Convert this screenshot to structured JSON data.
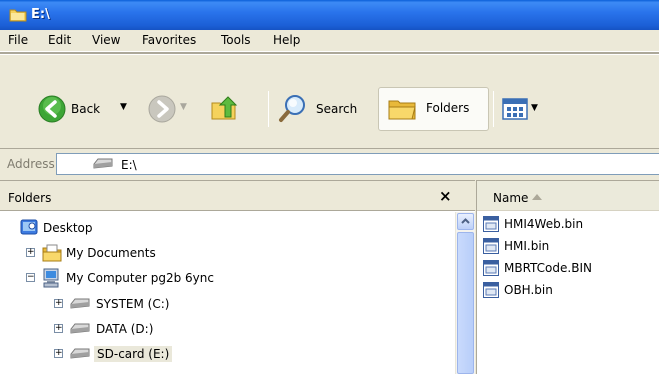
{
  "window": {
    "title": "E:\\"
  },
  "menu": [
    "File",
    "Edit",
    "View",
    "Favorites",
    "Tools",
    "Help"
  ],
  "toolbar": {
    "back_label": "Back",
    "search_label": "Search",
    "folders_label": "Folders"
  },
  "address": {
    "label": "Address",
    "value": "E:\\"
  },
  "folders_pane": {
    "title": "Folders",
    "close_glyph": "×",
    "tree": [
      {
        "label": "Desktop",
        "icon": "desktop-icon"
      },
      {
        "label": "My Documents",
        "icon": "my-documents-icon",
        "expander": "+"
      },
      {
        "label": "My Computer pg2b 6ync",
        "icon": "my-computer-icon",
        "expander": "−"
      },
      {
        "label": "SYSTEM (C:)",
        "icon": "drive-icon",
        "expander": "+"
      },
      {
        "label": "DATA (D:)",
        "icon": "drive-icon",
        "expander": "+"
      },
      {
        "label": "SD-card (E:)",
        "icon": "drive-icon",
        "expander": "+",
        "selected": true
      }
    ]
  },
  "files_pane": {
    "column_name": "Name",
    "files": [
      "HMI4Web.bin",
      "HMI.bin",
      "MBRTCode.BIN",
      "OBH.bin"
    ]
  },
  "colors": {
    "titlebar": "#2A74EC",
    "chrome": "#ECE9D8",
    "back_green": "#3DA536"
  }
}
